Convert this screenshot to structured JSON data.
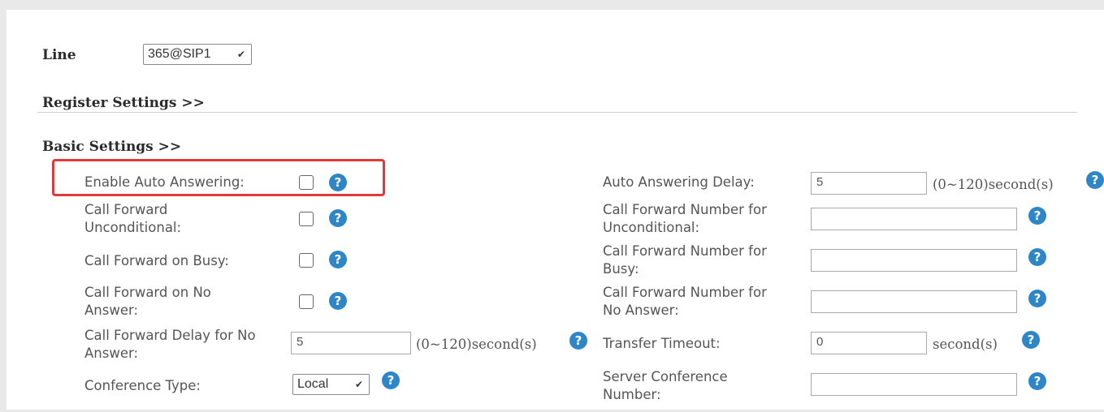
{
  "line": {
    "label": "Line",
    "selected": "365@SIP1"
  },
  "sections": {
    "register": "Register Settings >>",
    "basic": "Basic Settings >>"
  },
  "left": {
    "auto_answer": {
      "label": "Enable Auto Answering:"
    },
    "fwd_uncond": {
      "label_line1": "Call Forward",
      "label_line2": "Unconditional:"
    },
    "fwd_busy": {
      "label": "Call Forward on Busy:"
    },
    "fwd_noans": {
      "label_line1": "Call Forward on No",
      "label_line2": "Answer:"
    },
    "fwd_delay": {
      "label_line1": "Call Forward Delay for No",
      "label_line2": "Answer:",
      "value": "5",
      "unit": "(0~120)second(s)"
    },
    "conf_type": {
      "label": "Conference Type:",
      "selected": "Local"
    }
  },
  "right": {
    "auto_delay": {
      "label": "Auto Answering Delay:",
      "value": "5",
      "unit": "(0~120)second(s)"
    },
    "fwd_num_uncond": {
      "label_line1": "Call Forward Number for",
      "label_line2": "Unconditional:",
      "value": ""
    },
    "fwd_num_busy": {
      "label_line1": "Call Forward Number for",
      "label_line2": "Busy:",
      "value": ""
    },
    "fwd_num_noans": {
      "label_line1": "Call Forward Number for",
      "label_line2": "No Answer:",
      "value": ""
    },
    "transfer_timeout": {
      "label": "Transfer Timeout:",
      "value": "0",
      "unit": "second(s)"
    },
    "server_conf": {
      "label_line1": "Server Conference",
      "label_line2": "Number:",
      "value": ""
    }
  },
  "colors": {
    "help_icon": "#2f86c7",
    "highlight": "#e23a3a"
  },
  "icons": {
    "help": "help-circle-icon",
    "chevron": "chevron-down-icon"
  }
}
